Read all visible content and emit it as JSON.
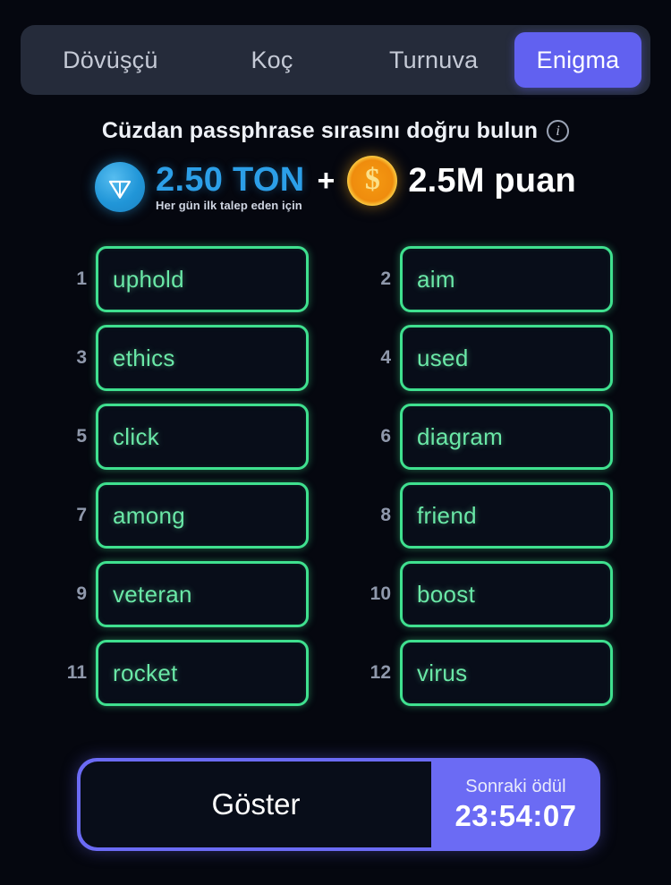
{
  "theme": {
    "background": "#05070f",
    "tabbar_bg": "#252b3a",
    "accent_purple": "#6161f0",
    "word_green": "#3fe08f",
    "ton_blue": "#2c9fe8",
    "coin_gold": "#ef8c0d"
  },
  "tabs": [
    {
      "label": "Dövüşçü",
      "active": false
    },
    {
      "label": "Koç",
      "active": false
    },
    {
      "label": "Turnuva",
      "active": false
    },
    {
      "label": "Enigma",
      "active": true
    }
  ],
  "header": {
    "title": "Cüzdan passphrase sırasını doğru bulun",
    "info_icon": "info-icon",
    "info_glyph": "i"
  },
  "reward": {
    "ton_icon": "ton-coin-icon",
    "ton_amount": "2.50 TON",
    "ton_subtitle": "Her gün ilk talep eden için",
    "separator": "+",
    "coin_icon": "gold-coin-icon",
    "coin_glyph": "$",
    "points_amount": "2.5M puan"
  },
  "words": [
    {
      "number": "1",
      "word": "uphold"
    },
    {
      "number": "2",
      "word": "aim"
    },
    {
      "number": "3",
      "word": "ethics"
    },
    {
      "number": "4",
      "word": "used"
    },
    {
      "number": "5",
      "word": "click"
    },
    {
      "number": "6",
      "word": "diagram"
    },
    {
      "number": "7",
      "word": "among"
    },
    {
      "number": "8",
      "word": "friend"
    },
    {
      "number": "9",
      "word": "veteran"
    },
    {
      "number": "10",
      "word": "boost"
    },
    {
      "number": "11",
      "word": "rocket"
    },
    {
      "number": "12",
      "word": "virus"
    }
  ],
  "footer": {
    "reveal_label": "Göster",
    "timer_label": "Sonraki ödül",
    "timer_value": "23:54:07"
  }
}
